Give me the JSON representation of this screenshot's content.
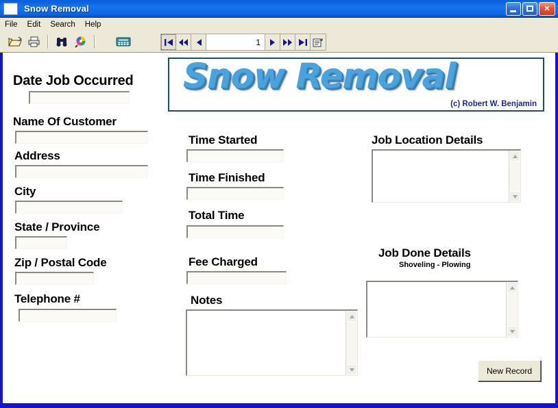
{
  "window": {
    "title": "Snow Removal",
    "icon": "blank-document-icon",
    "controls": {
      "minimize": "Minimize",
      "maximize": "Maximize",
      "close": "Close"
    }
  },
  "menubar": {
    "items": [
      {
        "label": "File"
      },
      {
        "label": "Edit"
      },
      {
        "label": "Search"
      },
      {
        "label": "Help"
      }
    ]
  },
  "toolbar": {
    "buttons": [
      {
        "name": "open-folder-icon",
        "title": "Open"
      },
      {
        "name": "printer-icon",
        "title": "Print"
      },
      {
        "name": "binoculars-icon",
        "title": "Find"
      },
      {
        "name": "palette-globe-icon",
        "title": "Options"
      },
      {
        "name": "calculator-icon",
        "title": "Calculator"
      }
    ],
    "navigation": {
      "first_label": "First Record",
      "prev_page_label": "Previous Page",
      "prev_label": "Previous Record",
      "record_number": "1",
      "next_label": "Next Record",
      "next_page_label": "Next Page",
      "last_label": "Last Record",
      "properties_label": "Record Properties"
    }
  },
  "banner": {
    "title": "Snow Removal",
    "credit": "(c) Robert W. Benjamin",
    "title_color": "#4aa3dd",
    "credit_color": "#1a2a8c",
    "border_color": "#1d4e68"
  },
  "form": {
    "border_color": "#1414c8",
    "fields": {
      "date_job_occurred": {
        "label": "Date Job Occurred",
        "value": ""
      },
      "name_of_customer": {
        "label": "Name Of Customer",
        "value": ""
      },
      "address": {
        "label": "Address",
        "value": ""
      },
      "city": {
        "label": "City",
        "value": ""
      },
      "state_province": {
        "label": "State / Province",
        "value": ""
      },
      "zip_postal_code": {
        "label": "Zip / Postal Code",
        "value": ""
      },
      "telephone": {
        "label": "Telephone #",
        "value": ""
      },
      "time_started": {
        "label": "Time Started",
        "value": ""
      },
      "time_finished": {
        "label": "Time Finished",
        "value": ""
      },
      "total_time": {
        "label": "Total Time",
        "value": ""
      },
      "fee_charged": {
        "label": "Fee Charged",
        "value": ""
      },
      "notes": {
        "label": "Notes",
        "value": ""
      },
      "job_location_details": {
        "label": "Job Location Details",
        "value": ""
      },
      "job_done_details": {
        "label": "Job Done Details",
        "sublabel": "Shoveling - Plowing",
        "value": ""
      }
    },
    "new_record_button": "New Record"
  }
}
